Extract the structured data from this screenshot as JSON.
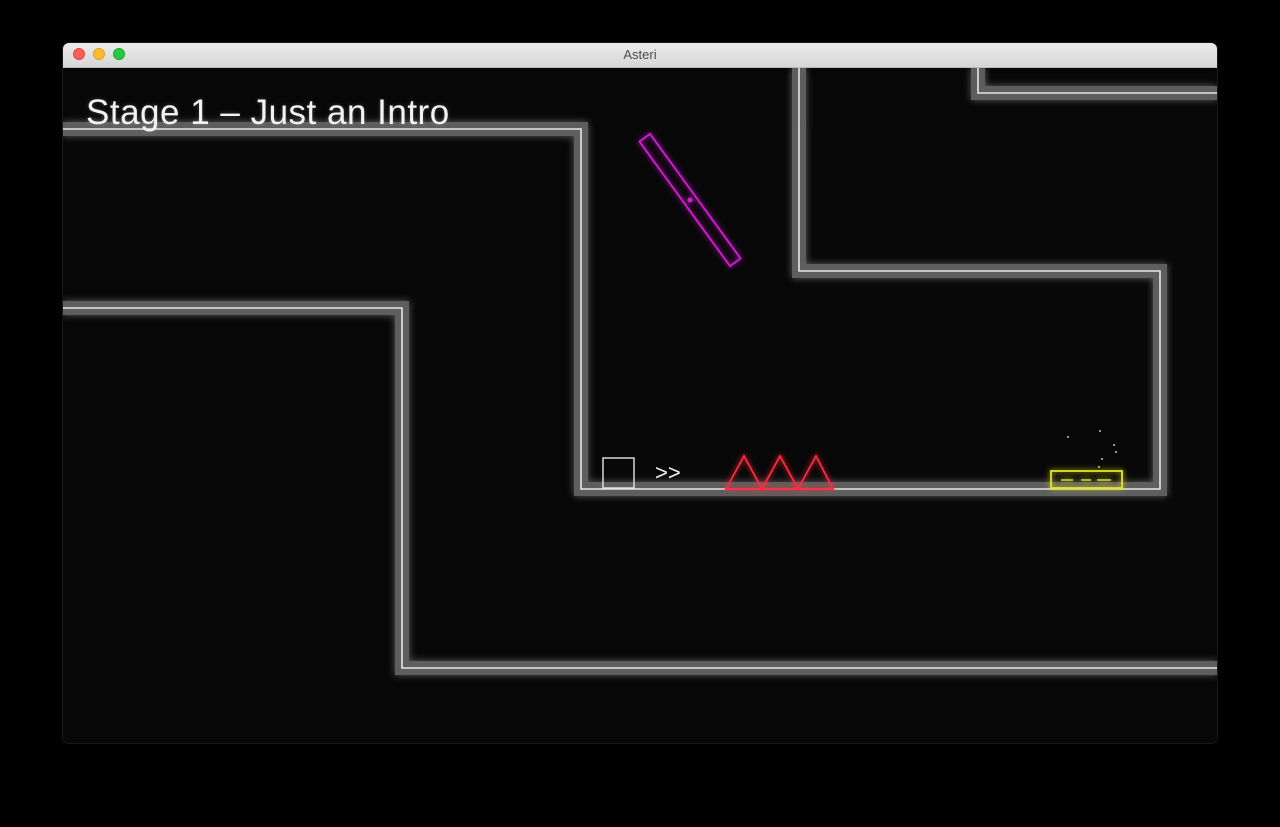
{
  "window": {
    "title": "Asteri"
  },
  "game": {
    "stage_title": "Stage 1 – Just an Intro",
    "direction_hint": ">>",
    "colors": {
      "background": "#070707",
      "wall": "#e6e6e6",
      "hazard_spikes": "#ff2a3c",
      "rotating_platform": "#d41ad4",
      "goal_pad": "#e6e61a"
    },
    "entities": {
      "player": "square",
      "spikes": {
        "type": "triangle",
        "count": 3
      },
      "rotating_platform": "rotating-bar",
      "goal": "launch-pad"
    }
  }
}
